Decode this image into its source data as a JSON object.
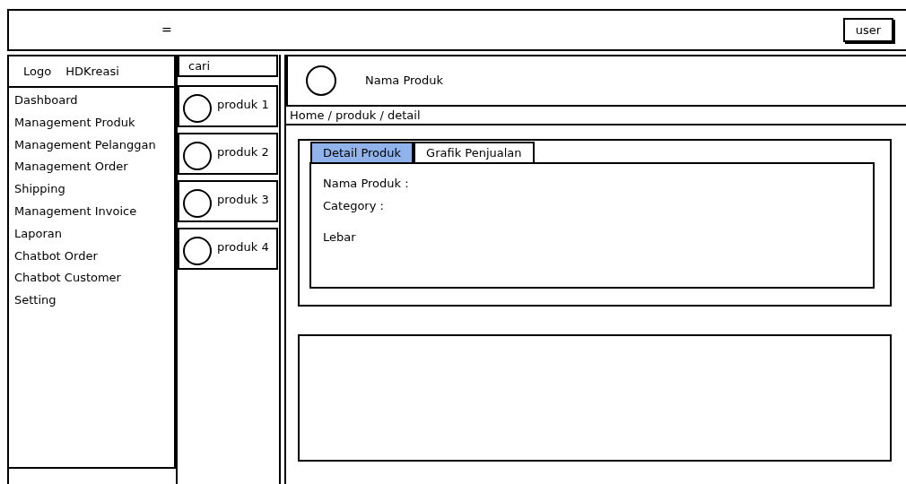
{
  "top_bar": {
    "menu_glyph": "=",
    "user_button": "user"
  },
  "sidebar": {
    "logo": "Logo",
    "brand": "HDKreasi",
    "items": [
      "Dashboard",
      "Management Produk",
      "Management Pelanggan",
      "Management Order",
      "Shipping",
      "Management Invoice",
      "Laporan",
      "Chatbot Order",
      "Chatbot Customer",
      "Setting"
    ]
  },
  "product_list": {
    "search": {
      "value": "cari"
    },
    "items": [
      {
        "label": "produk 1"
      },
      {
        "label": "produk 2"
      },
      {
        "label": "produk 3"
      },
      {
        "label": "produk 4"
      }
    ]
  },
  "header": {
    "title": "Nama Produk"
  },
  "breadcrumb": "Home / produk / detail",
  "tabs": [
    {
      "label": "Detail Produk",
      "selected": true
    },
    {
      "label": "Grafik Penjualan",
      "selected": false
    }
  ],
  "detail_fields": [
    "Nama Produk :",
    "Category :",
    "Lebar"
  ]
}
